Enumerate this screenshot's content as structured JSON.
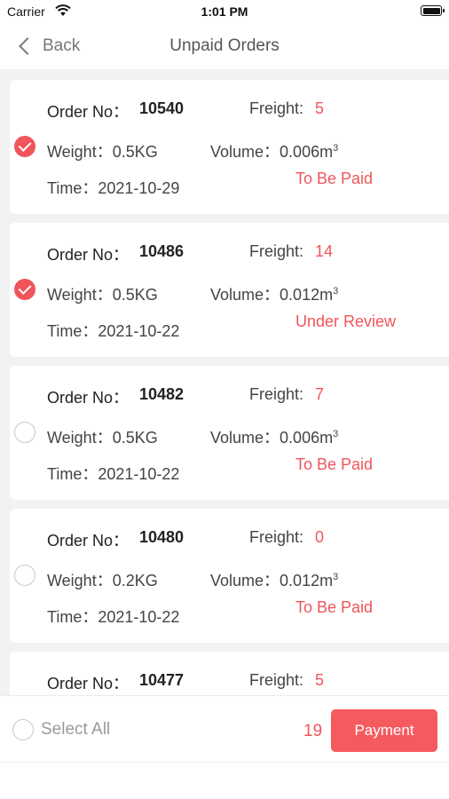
{
  "status_bar": {
    "carrier": "Carrier",
    "time": "1:01 PM"
  },
  "nav": {
    "back_label": "Back",
    "title": "Unpaid Orders"
  },
  "labels": {
    "order_no": "Order No：",
    "freight": "Freight: ",
    "weight": "Weight：",
    "volume": "Volume：",
    "time": "Time：",
    "volume_unit": "m",
    "volume_sup": "3"
  },
  "orders": [
    {
      "order_no": "10540",
      "freight": "5",
      "weight": "0.5KG",
      "volume": "0.006",
      "time": "2021-10-29",
      "status": "To Be Paid",
      "checked": true
    },
    {
      "order_no": "10486",
      "freight": "14",
      "weight": "0.5KG",
      "volume": "0.012",
      "time": "2021-10-22",
      "status": "Under Review",
      "checked": true
    },
    {
      "order_no": "10482",
      "freight": "7",
      "weight": "0.5KG",
      "volume": "0.006",
      "time": "2021-10-22",
      "status": "To Be Paid",
      "checked": false
    },
    {
      "order_no": "10480",
      "freight": "0",
      "weight": "0.2KG",
      "volume": "0.012",
      "time": "2021-10-22",
      "status": "To Be Paid",
      "checked": false
    },
    {
      "order_no": "10477",
      "freight": "5"
    }
  ],
  "footer": {
    "select_all_label": "Select All",
    "total": "19",
    "payment_label": "Payment"
  },
  "colors": {
    "accent": "#f0555b",
    "button": "#f55a5f",
    "background": "#f2f2f2"
  }
}
